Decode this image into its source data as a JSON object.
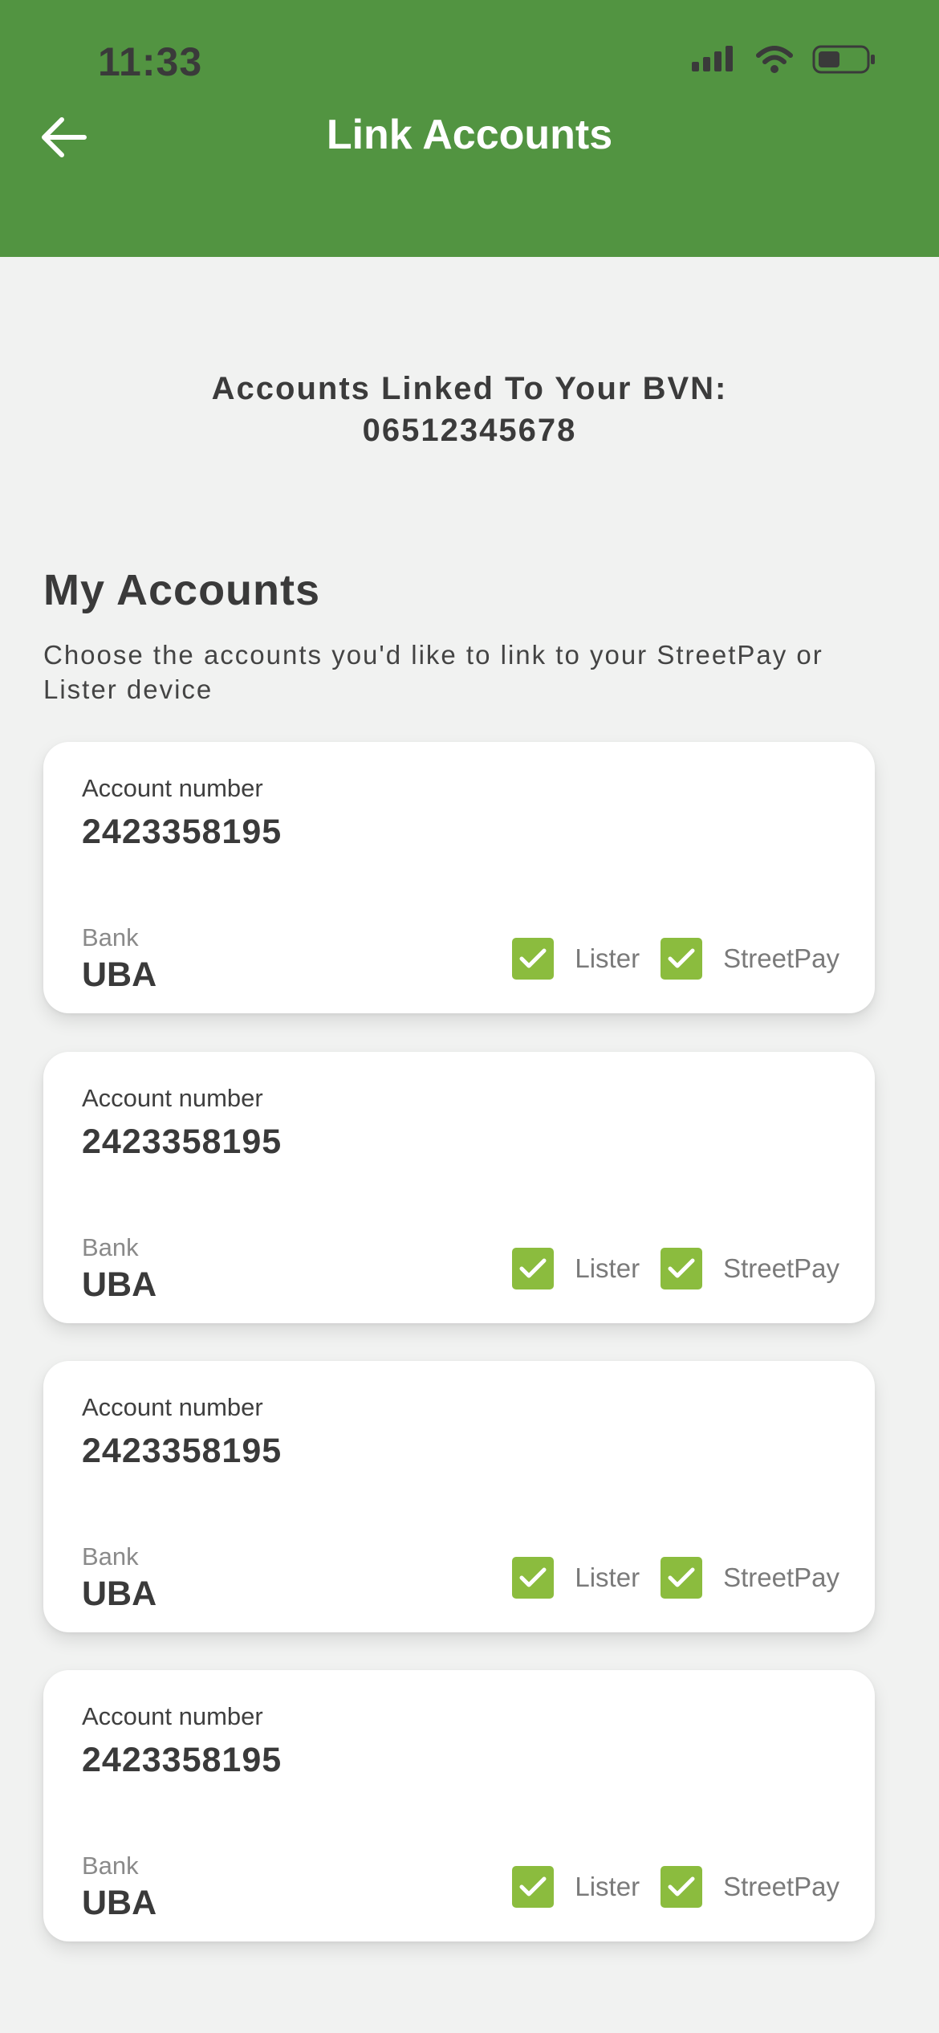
{
  "status_bar": {
    "time": "11:33"
  },
  "header": {
    "title": "Link Accounts",
    "back_icon": "arrow-left-icon"
  },
  "bvn_heading": {
    "line1": "Accounts Linked To Your BVN:",
    "line2": "06512345678"
  },
  "section": {
    "title": "My Accounts",
    "description": "Choose the accounts you'd like to link to your StreetPay or Lister device"
  },
  "labels": {
    "account_number": "Account number",
    "bank": "Bank"
  },
  "accounts": [
    {
      "account_number": "2423358195",
      "bank": "UBA",
      "lister_label": "Lister",
      "lister_checked": true,
      "streetpay_label": "StreetPay",
      "streetpay_checked": true
    },
    {
      "account_number": "2423358195",
      "bank": "UBA",
      "lister_label": "Lister",
      "lister_checked": true,
      "streetpay_label": "StreetPay",
      "streetpay_checked": true
    },
    {
      "account_number": "2423358195",
      "bank": "UBA",
      "lister_label": "Lister",
      "lister_checked": true,
      "streetpay_label": "StreetPay",
      "streetpay_checked": true
    },
    {
      "account_number": "2423358195",
      "bank": "UBA",
      "lister_label": "Lister",
      "lister_checked": true,
      "streetpay_label": "StreetPay",
      "streetpay_checked": true
    }
  ],
  "colors": {
    "header": "#529441",
    "checkbox": "#8bbc3e",
    "background": "#f1f2f1"
  }
}
